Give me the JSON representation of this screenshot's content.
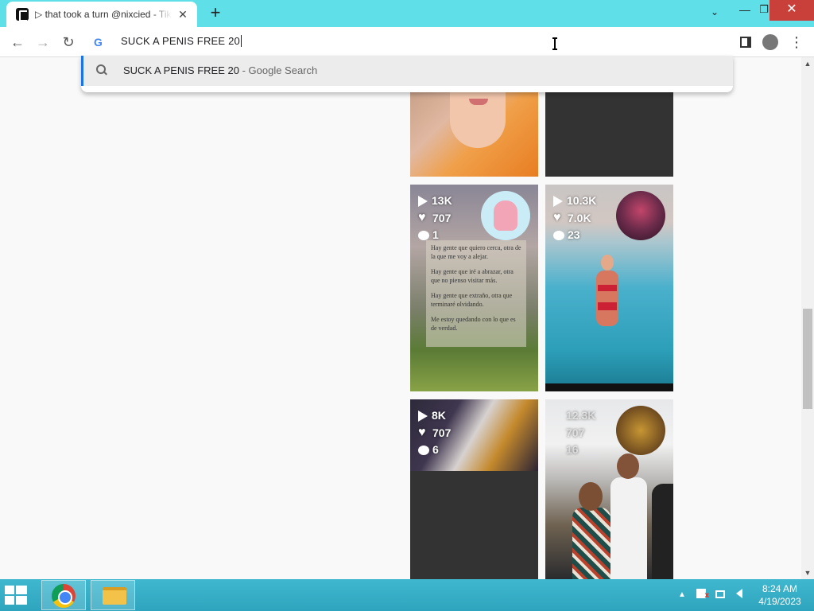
{
  "tab": {
    "title": "▷ that took a turn @nixcied - TikTok",
    "close": "✕",
    "new_tab": "+"
  },
  "window": {
    "minimize": "—",
    "restore": "❐",
    "close": "✕",
    "tab_search": "⌄"
  },
  "toolbar": {
    "back": "←",
    "forward": "→",
    "reload": "↻",
    "menu": "⋮"
  },
  "omnibox": {
    "value": "SUCK A PENIS FREE 20",
    "google_icon": "G"
  },
  "suggestion": {
    "query": "SUCK A PENIS FREE 20",
    "separator": " - ",
    "source": "Google Search"
  },
  "cards": [
    {
      "views": "13K",
      "likes": "707",
      "comments": "1"
    },
    {
      "views": "10.3K",
      "likes": "7.0K",
      "comments": "23"
    },
    {
      "views": "8K",
      "likes": "707",
      "comments": "6"
    },
    {
      "views": "12.3K",
      "likes": "707",
      "comments": "16"
    }
  ],
  "poem": [
    "Hay gente que quiero cerca, otra de la que me voy a alejar.",
    "Hay gente que iré a abrazar, otra que no pienso visitar más.",
    "Hay gente que extraño, otra que terminaré olvidando.",
    "Me estoy quedando con lo que es de verdad."
  ],
  "scrollbar": {
    "up": "▲",
    "down": "▼"
  },
  "taskbar": {
    "clock_time": "8:24 AM",
    "clock_date": "4/19/2023",
    "tray_up": "▲"
  }
}
